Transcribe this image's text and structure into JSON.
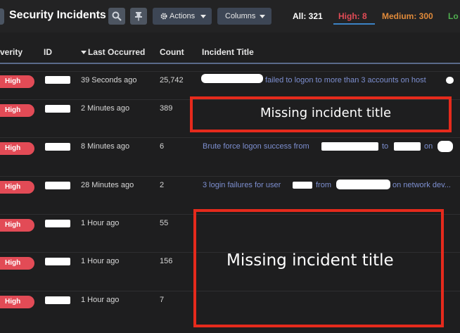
{
  "header": {
    "title": "Security Incidents",
    "search_icon": "search-icon",
    "pin_icon": "pin-icon",
    "actions_label": "Actions",
    "actions_icon": "gear-icon",
    "columns_label": "Columns"
  },
  "stats": {
    "all": "All: 321",
    "high": "High: 8",
    "medium": "Medium: 300",
    "low": "Lo"
  },
  "colors": {
    "high": "#e24b56",
    "medium": "#e08a3a",
    "low": "#4fae4f",
    "link": "#7d8fd0",
    "annotation": "#e52a1c"
  },
  "columns": [
    "verity",
    "ID",
    "Last Occurred",
    "Count",
    "Incident Title"
  ],
  "sorted_column": "Last Occurred",
  "rows": [
    {
      "severity": "High",
      "last_occurred": "39 Seconds ago",
      "count": "25,742",
      "title_a": "failed to logon to more than 3 accounts on host"
    },
    {
      "severity": "High",
      "last_occurred": "2 Minutes ago",
      "count": "389"
    },
    {
      "severity": "High",
      "last_occurred": "8 Minutes ago",
      "count": "6",
      "title_a": "Brute force logon success from",
      "title_b": "to",
      "title_c": "on"
    },
    {
      "severity": "High",
      "last_occurred": "28 Minutes ago",
      "count": "2",
      "title_a": "3 login failures for user",
      "title_b": "from",
      "title_c": "on network dev..."
    },
    {
      "severity": "High",
      "last_occurred": "1 Hour ago",
      "count": "55"
    },
    {
      "severity": "High",
      "last_occurred": "1 Hour ago",
      "count": "156"
    },
    {
      "severity": "High",
      "last_occurred": "1 Hour ago",
      "count": "7"
    }
  ],
  "annotations": [
    "Missing incident title",
    "Missing incident title"
  ]
}
